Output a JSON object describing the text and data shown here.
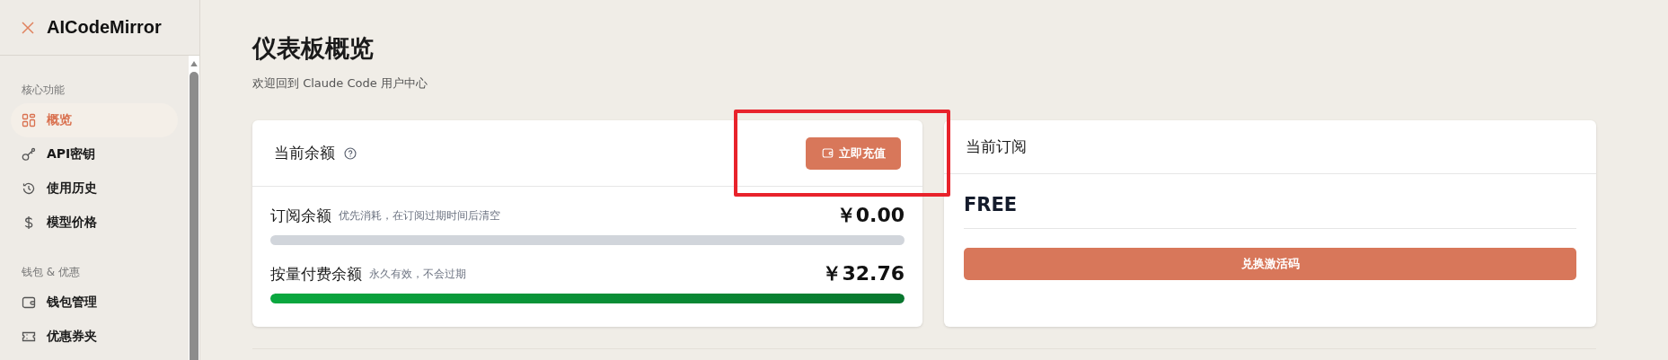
{
  "sidebar": {
    "logo": "AICodeMirror",
    "sections": [
      {
        "title": "核心功能",
        "items": [
          {
            "label": "概览",
            "selected": true
          },
          {
            "label": "API密钥",
            "selected": false
          },
          {
            "label": "使用历史",
            "selected": false
          },
          {
            "label": "模型价格",
            "selected": false
          }
        ]
      },
      {
        "title": "钱包 & 优惠",
        "items": [
          {
            "label": "钱包管理",
            "selected": false
          },
          {
            "label": "优惠券夹",
            "selected": false
          }
        ]
      }
    ]
  },
  "page": {
    "title": "仪表板概览",
    "subtitle": "欢迎回到 Claude Code 用户中心"
  },
  "balance_card": {
    "title": "当前余额",
    "button": "立即充值",
    "rows": [
      {
        "label": "订阅余额",
        "hint": "优先消耗，在订阅过期时间后清空",
        "amount": "￥0.00",
        "level": 0
      },
      {
        "label": "按量付费余额",
        "hint": "永久有效，不会过期",
        "amount": "￥32.76",
        "level": 1
      }
    ]
  },
  "subscription_card": {
    "title": "当前订阅",
    "plan": "FREE",
    "button": "兑换激活码"
  }
}
